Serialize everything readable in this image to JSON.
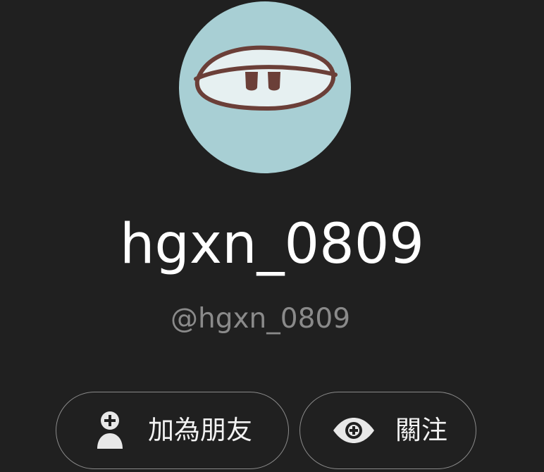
{
  "profile": {
    "display_name": "hgxn_0809",
    "handle": "@hgxn_0809",
    "avatar_icon": "sleepy-eye-avatar",
    "avatar_bg": "#a8cfd4"
  },
  "actions": {
    "add_friend": {
      "label": "加為朋友",
      "icon": "add-person-icon"
    },
    "follow": {
      "label": "關注",
      "icon": "eye-plus-icon"
    }
  },
  "colors": {
    "background": "#202020",
    "text_primary": "#ffffff",
    "text_secondary": "#8a8a8a",
    "button_border": "#8a8a8a"
  }
}
